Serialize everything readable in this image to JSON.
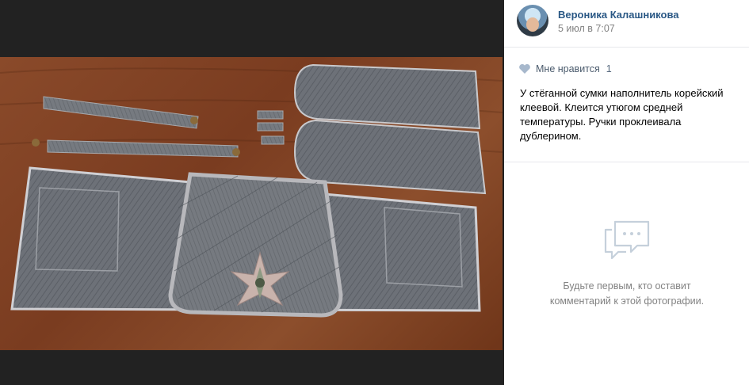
{
  "post": {
    "author_name": "Вероника Калашникова",
    "date": "5 июл в 7:07",
    "likes_label": "Мне нравится",
    "likes_count": "1",
    "caption": "У стёганной сумки наполнитель корейский клеевой. Клеится утюгом средней температуры. Ручки проклеивала дублерином."
  },
  "comments": {
    "empty_text_line1": "Будьте первым, кто оставит",
    "empty_text_line2": "комментарий к этой фотографии."
  },
  "photo": {
    "subject": "quilted-denim-bag-pieces-icon"
  },
  "colors": {
    "link": "#2a5885",
    "muted": "#828282",
    "viewer_bg": "#222222"
  }
}
